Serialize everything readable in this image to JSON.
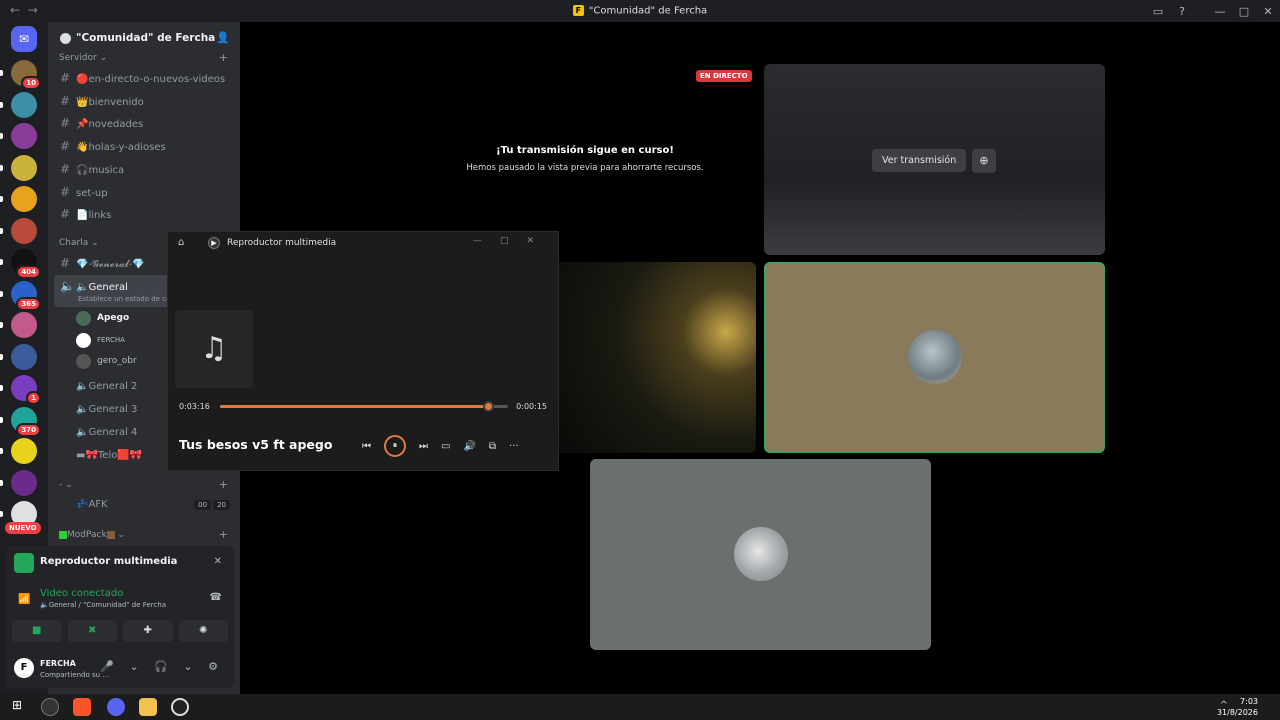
{
  "window": {
    "title": "\"Comunidad\" de Fercha",
    "back": "←",
    "forward": "→"
  },
  "guild": {
    "name": "\"Comunidad\" de Fercha",
    "chevron": "⌄"
  },
  "servers": [
    {
      "badge": "10",
      "color": "#8a6a3a"
    },
    {
      "badge": "",
      "color": "#3d8fa8"
    },
    {
      "badge": "",
      "color": "#8a3e9a"
    },
    {
      "badge": "",
      "color": "#c9b13a"
    },
    {
      "badge": "",
      "color": "#e8a21c"
    },
    {
      "badge": "",
      "color": "#b84a3c"
    },
    {
      "badge": "404",
      "color": "#111111"
    },
    {
      "badge": "365",
      "color": "#2a62c9"
    },
    {
      "badge": "",
      "color": "#c25a8c"
    },
    {
      "badge": "",
      "color": "#3b5b9a"
    },
    {
      "badge": "1",
      "color": "#7a3dc2"
    },
    {
      "badge": "370",
      "color": "#1fa39a"
    },
    {
      "badge": "",
      "color": "#e8d21c"
    },
    {
      "badge": "",
      "color": "#6a2a8a"
    },
    {
      "badge": "",
      "color": "#e0e0e0"
    }
  ],
  "new_label": "NUEVO",
  "categories": {
    "servidor": "Servidor",
    "charla": "Charla",
    "dash": "-",
    "modpack": "ModPack"
  },
  "text_channels": [
    {
      "name": "🔴en-directo-o-nuevos-videos"
    },
    {
      "name": "👑bienvenido"
    },
    {
      "name": "📌novedades"
    },
    {
      "name": "👋holas-y-adioses"
    },
    {
      "name": "🎧musica"
    },
    {
      "name": "set-up"
    },
    {
      "name": "📄links"
    }
  ],
  "charla_channels": {
    "general_text": "💎-𝓖𝓮𝓷𝓮𝓻𝓪𝓵-💎",
    "general_voice": "🔈General",
    "general_status": "Establece un estado de canal",
    "voice_users": [
      "Apego",
      "FERCHA",
      "gero_obr"
    ],
    "general2": "🔈General 2",
    "general3": "🔈General 3",
    "general4": "🔈General 4",
    "telo": "▬🎀Telo🟥🎀",
    "afk": "💤AFK",
    "afk_counts": [
      "00",
      "20"
    ]
  },
  "activity": {
    "title": "Reproductor multimedia",
    "close": "✕"
  },
  "rtc": {
    "status": "Video conectado",
    "location": "🔈General / \"Comunidad\" de Fercha"
  },
  "action_icons": [
    "■",
    "✖",
    "✚",
    "✺"
  ],
  "user": {
    "name": "FERCHA",
    "status": "Compartiendo su ...",
    "initial": "F",
    "controls": "🎤 ⌄ 🎧 ⌄ ⚙"
  },
  "stage": {
    "live_badge": "EN DIRECTO",
    "paused_title": "¡Tu transmisión sigue en curso!",
    "paused_sub": "Hemos pausado la vista previa para ahorrarte recursos.",
    "watch_stream": "Ver transmisión",
    "eye": "⊕"
  },
  "media_player": {
    "title": "Reproductor multimedia",
    "elapsed": "0:03:16",
    "remaining": "0:00:15",
    "progress": 0.93,
    "song": "Tus besos v5 ft apego",
    "note_glyph": "♫",
    "controls": [
      "⏮",
      "⏸",
      "⏭",
      "▭",
      "🔊",
      "⧉",
      "···"
    ]
  },
  "taskbar": {
    "time": "7:03",
    "date": "31/8/2026",
    "tray": "^"
  },
  "colors": {
    "accent": "#23a55a",
    "live": "#da373c",
    "player": "#e07b3c"
  }
}
